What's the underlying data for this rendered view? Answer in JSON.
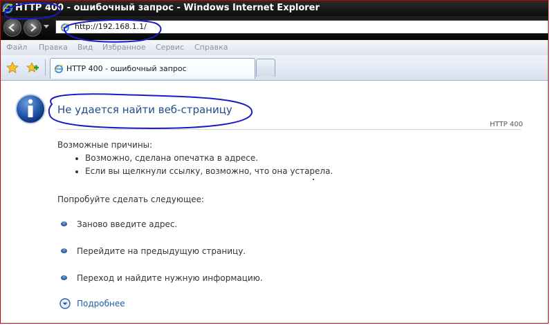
{
  "window": {
    "title": "HTTP 400 - ошибочный запрос - Windows Internet Explorer"
  },
  "address_bar": {
    "url": "http://192.168.1.1/"
  },
  "menu": {
    "items": [
      "Файл",
      "Правка",
      "Вид",
      "Избранное",
      "Сервис",
      "Справка"
    ]
  },
  "tabs": [
    {
      "label": "HTTP 400 - ошибочный запрос",
      "active": true
    }
  ],
  "page": {
    "title": "Не удается найти веб-страницу",
    "error_code": "HTTP 400",
    "causes_heading": "Возможные причины:",
    "causes": [
      "Возможно, сделана опечатка в адресе.",
      "Если вы щелкнули ссылку, возможно, что она устарела."
    ],
    "try_heading": "Попробуйте сделать следующее:",
    "actions": [
      "Заново введите адрес.",
      "Перейдите на предыдущую страницу.",
      "Переход   и найдите нужную информацию."
    ],
    "more_info": "Подробнее"
  },
  "icons": {
    "ie": "internet-explorer-icon",
    "back": "back-arrow-icon",
    "forward": "forward-arrow-icon",
    "favorites": "star-icon",
    "add_favorite": "add-favorite-icon",
    "info": "info-icon",
    "more": "chevron-down-circle-icon"
  },
  "colors": {
    "title_text": "#1f4d86",
    "annotation": "#1a1ac8",
    "frame_border": "#d00000"
  }
}
